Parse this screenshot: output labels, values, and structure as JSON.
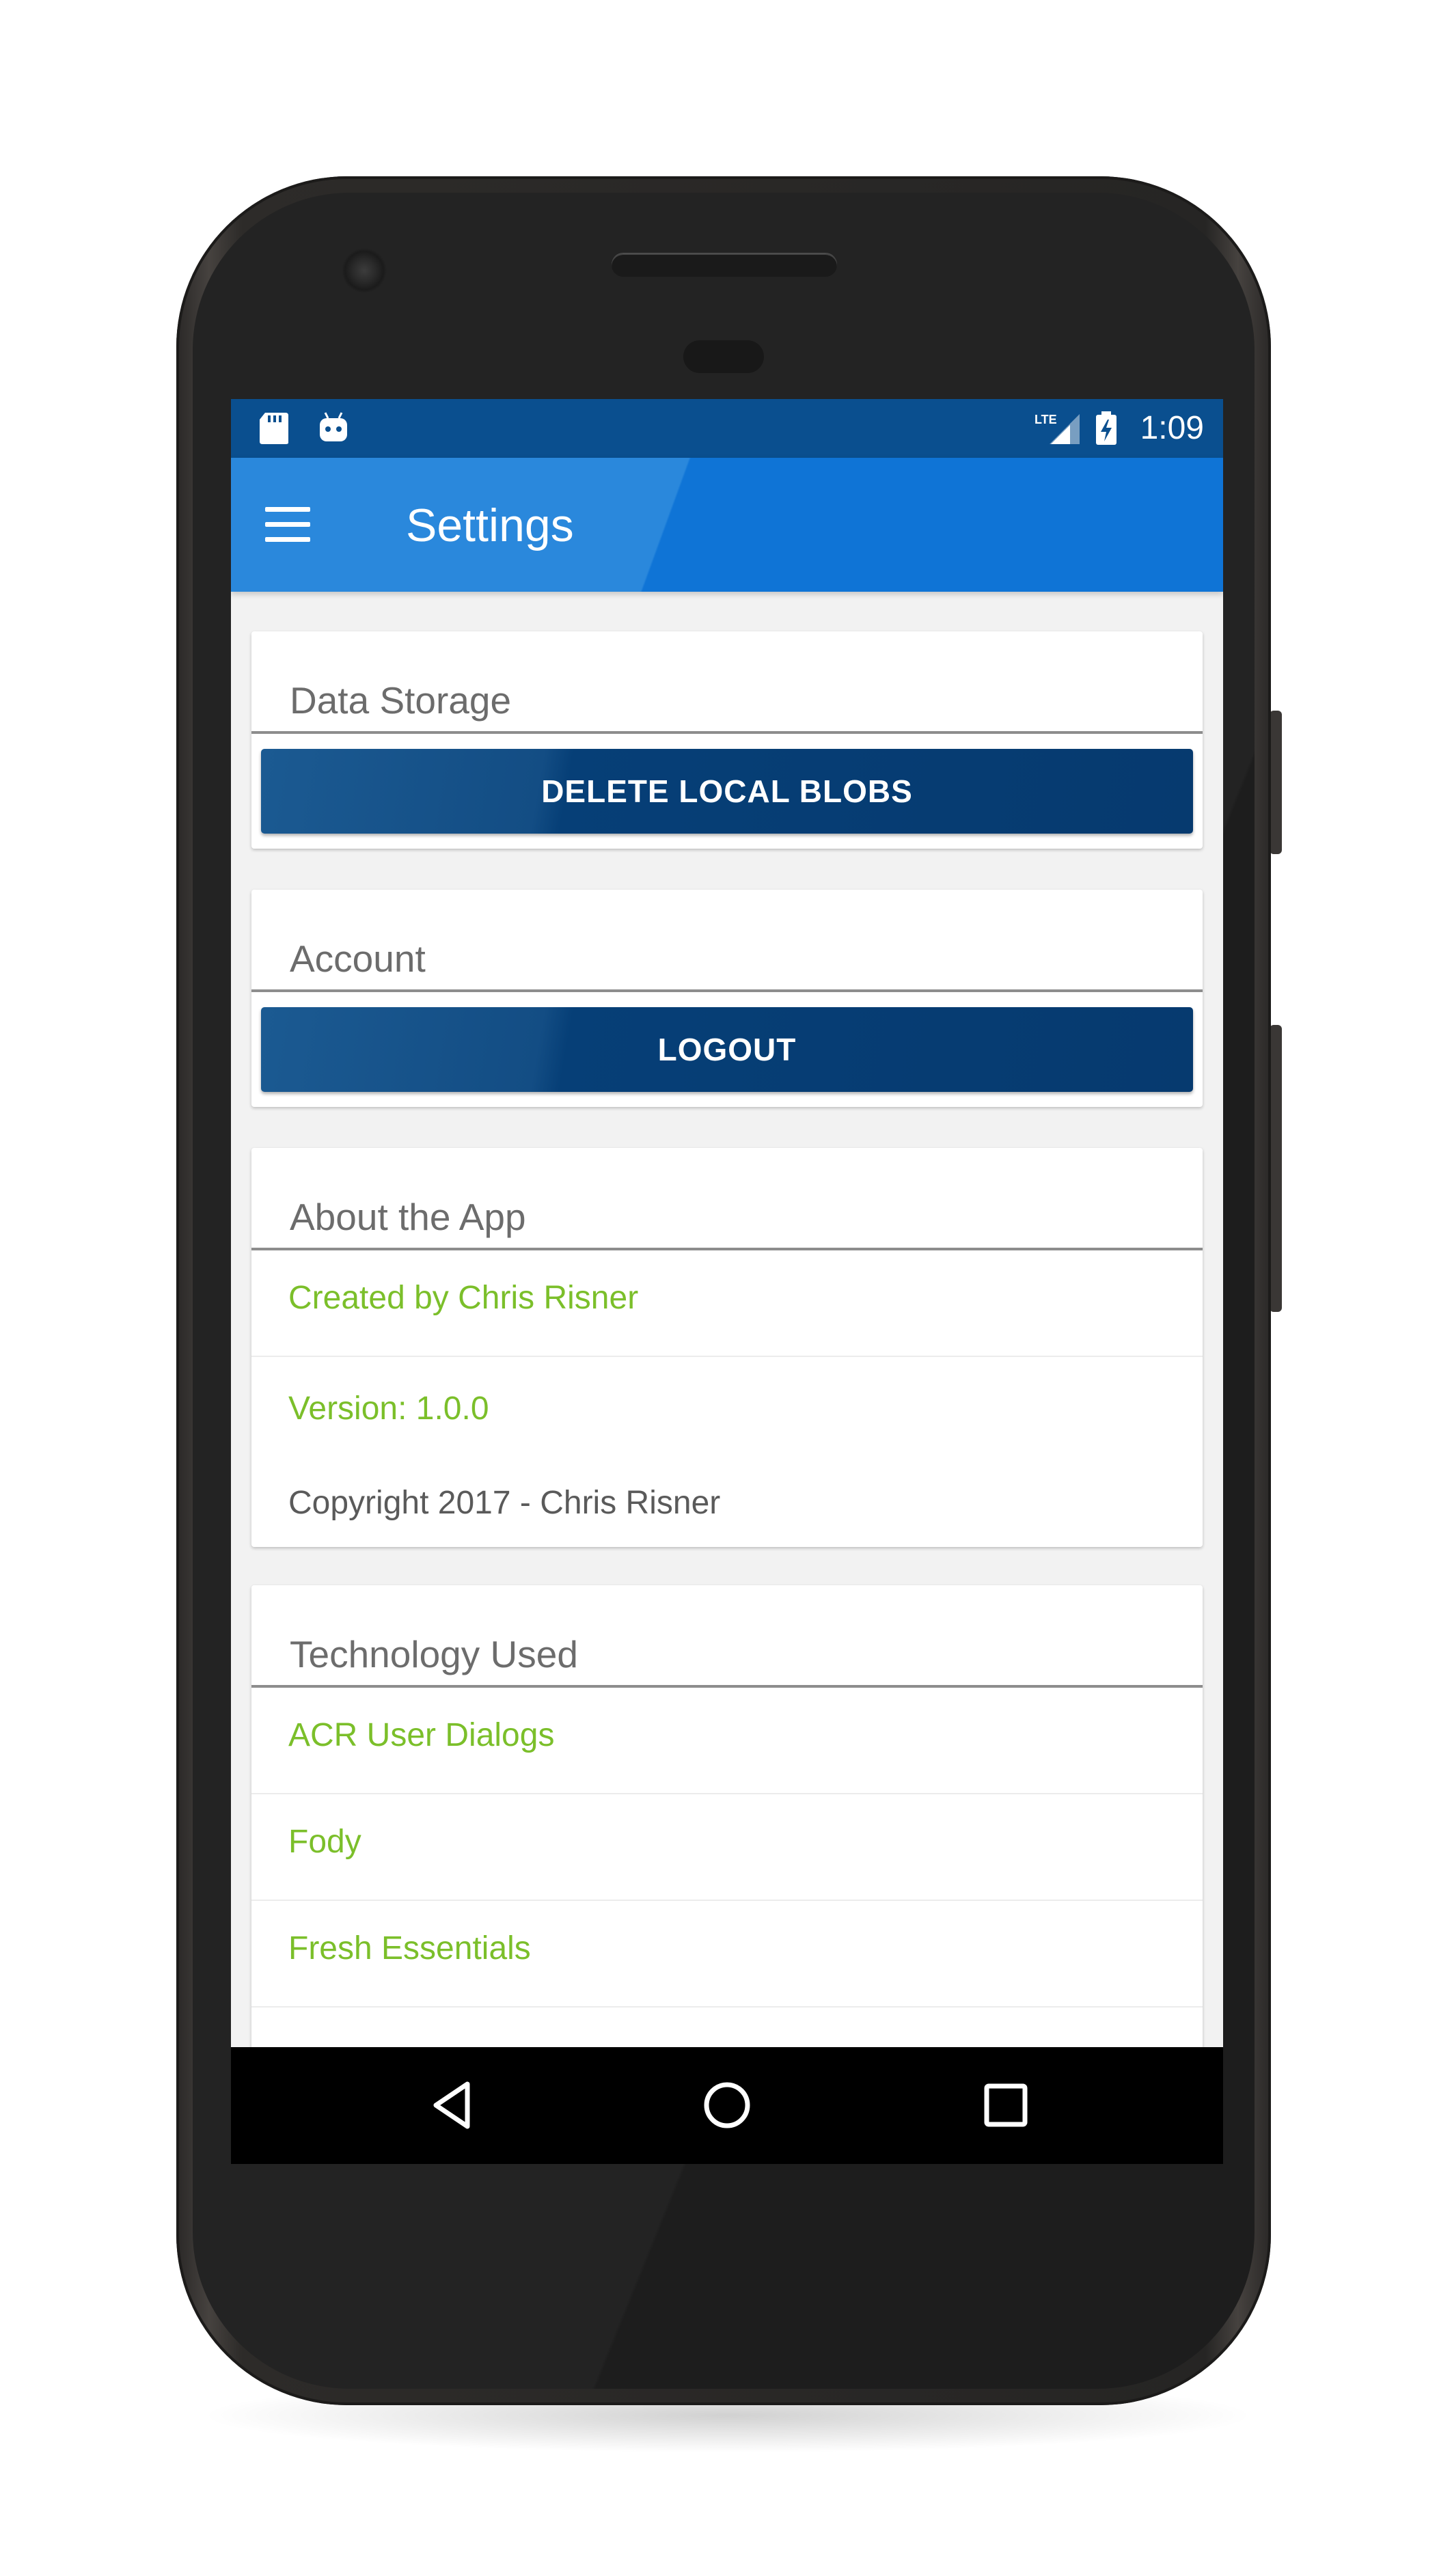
{
  "status_bar": {
    "time": "1:09",
    "left_icons": [
      "sd-card-icon",
      "android-icon"
    ],
    "right_icons": [
      "lte-signal-icon",
      "battery-charging-icon"
    ],
    "network_label": "LTE"
  },
  "app_bar": {
    "title": "Settings",
    "menu_icon": "hamburger-menu-icon"
  },
  "sections": {
    "data_storage": {
      "title": "Data Storage",
      "button_label": "DELETE LOCAL BLOBS"
    },
    "account": {
      "title": "Account",
      "button_label": "LOGOUT"
    },
    "about": {
      "title": "About the App",
      "items": [
        "Created by Chris Risner",
        "Version: 1.0.0"
      ],
      "copyright": "Copyright 2017 - Chris Risner"
    },
    "technology": {
      "title": "Technology Used",
      "items": [
        "ACR User Dialogs",
        "Fody",
        "Fresh Essentials"
      ]
    }
  },
  "nav_bar": {
    "icons": [
      "back-icon",
      "home-icon",
      "recents-icon"
    ]
  },
  "colors": {
    "status_bar": "#0a4f8f",
    "app_bar": "#0f74d6",
    "button": "#063a6f",
    "link_green": "#7bbf2a",
    "phone_body": "#232323"
  }
}
